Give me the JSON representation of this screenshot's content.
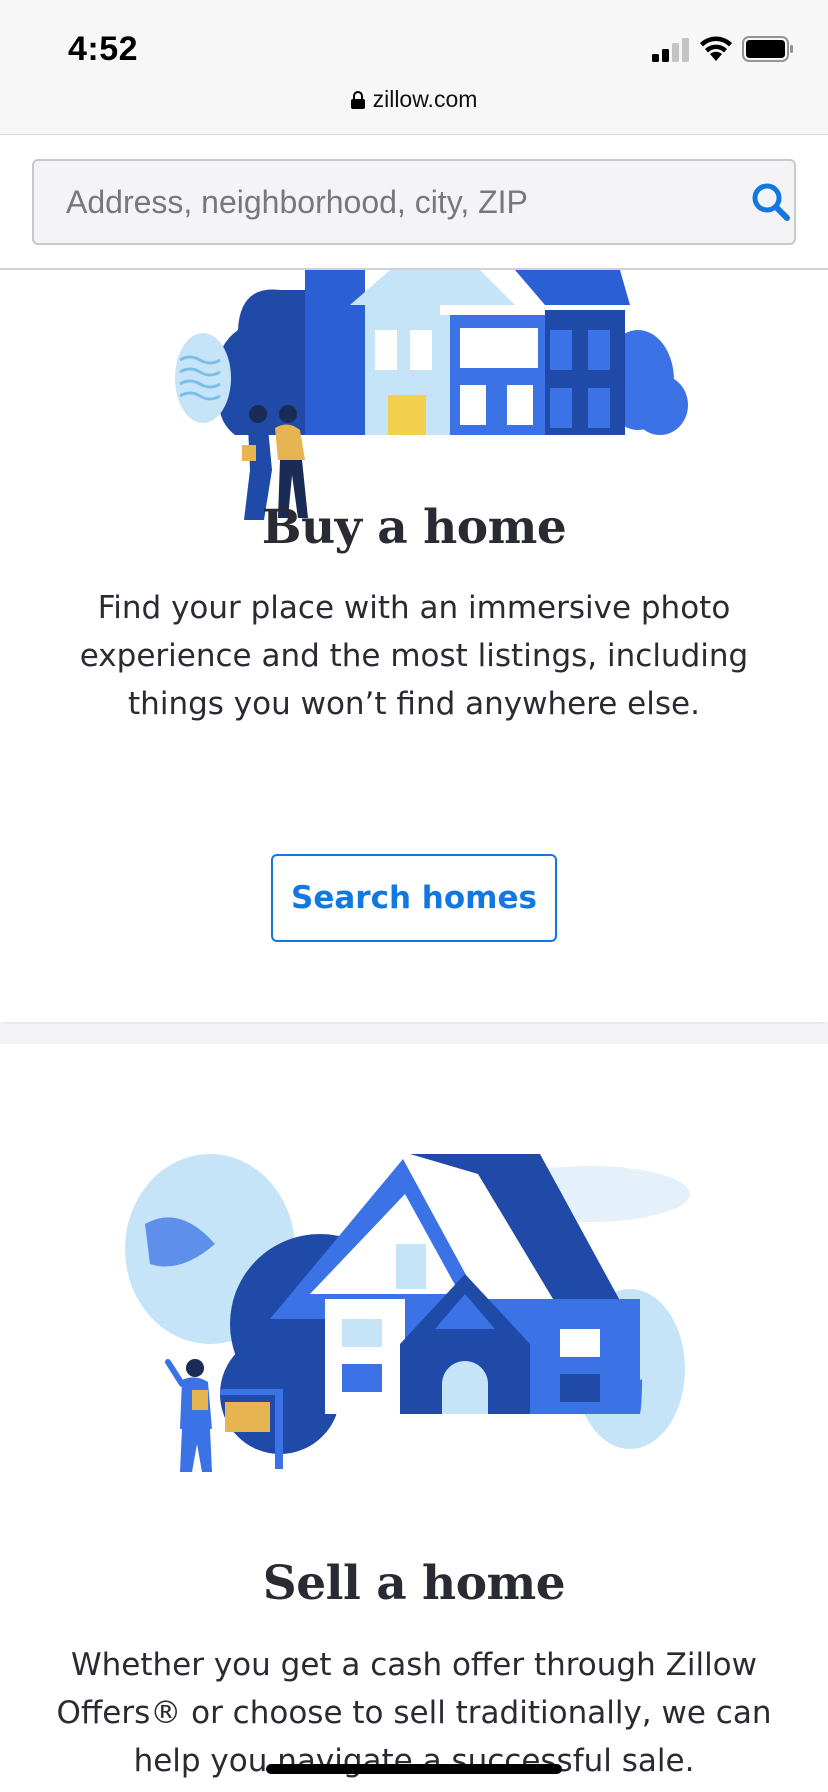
{
  "status_bar": {
    "time": "4:52",
    "url": "zillow.com",
    "icons": [
      "signal-icon",
      "wifi-icon",
      "battery-icon",
      "lock-icon"
    ]
  },
  "search": {
    "placeholder": "Address, neighborhood, city, ZIP",
    "value": "",
    "icon": "search-icon"
  },
  "buy": {
    "title": "Buy a home",
    "description": "Find your place with an immersive photo experience and the most listings, including things you won’t find anywhere else.",
    "button_label": "Search homes"
  },
  "sell": {
    "title": "Sell a home",
    "description": "Whether you get a cash offer through Zillow Offers® or choose to sell traditionally, we can help you navigate a successful sale."
  },
  "colors": {
    "brand_blue": "#1277e1",
    "dark_blue": "#1f4aa8",
    "mid_blue": "#3b73e6",
    "light_blue": "#c6e4f7",
    "accent_yellow": "#f3cf4e",
    "text": "#2a2a33"
  }
}
